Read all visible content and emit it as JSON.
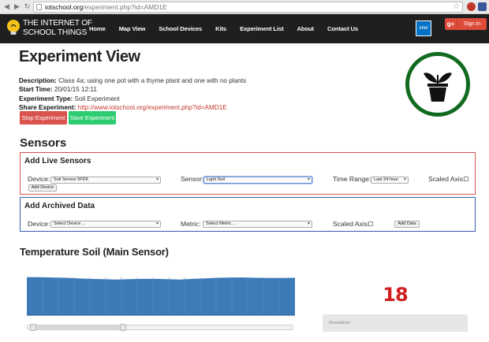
{
  "browser": {
    "url_host": "iotschool.org",
    "url_path": "/experiment.php?id=AMD1E"
  },
  "header": {
    "logo_line1": "THE INTERNET OF",
    "logo_line2": "SCHOOL THINGS",
    "nav": [
      "Home",
      "Map View",
      "School Devices",
      "Kits",
      "Experiment List",
      "About",
      "Contact Us"
    ],
    "intel_label": "intel",
    "signin_gplus": "g+",
    "signin_label": "Sign in"
  },
  "experiment": {
    "title": "Experiment View",
    "description_label": "Description:",
    "description": "Class 4a; using one pot with a thyme plant and one with no plants",
    "start_label": "Start Time:",
    "start_time": "20/01/15 12:11",
    "type_label": "Experiment Type:",
    "type": "Soil Experiment",
    "share_label": "Share Experiment:",
    "share_url": "http://www.iotschool.org/experiment.php?id=AMD1E",
    "stop_button": "Stop Experiment",
    "save_button": "Save Experiment"
  },
  "sensors": {
    "title": "Sensors",
    "live": {
      "title": "Add Live Sensors",
      "device_label": "Device:",
      "device_value": "Soil Sensor 5FD6",
      "sensor_label": "Sensor:",
      "sensor_value": "Light Soil",
      "time_range_label": "Time Range:",
      "time_range_value": "Last 24 hour",
      "scaled_axis_label": "Scaled Axis:",
      "add_button": "Add Device"
    },
    "archive": {
      "title": "Add Archived Data",
      "device_label": "Device:",
      "device_value": "Select Device ...",
      "metric_label": "Metric:",
      "metric_value": "Select Metric ...",
      "scaled_axis_label": "Scaled Axis:",
      "add_button": "Add Data"
    }
  },
  "chart_section": {
    "title": "Temperature Soil (Main Sensor)",
    "current_reading": "18",
    "resolution_label": "Resolution",
    "slider_range": [
      0.02,
      0.36
    ]
  },
  "chart_data": {
    "type": "area",
    "title": "",
    "xlabel": "",
    "ylabel": "",
    "series_color": "#3d7ab8",
    "y": [
      13.0,
      13.0,
      12.9,
      12.8,
      12.6,
      12.4,
      12.3,
      12.2,
      12.3,
      12.4,
      12.4,
      12.3,
      12.2,
      12.4,
      12.6,
      12.8,
      12.9,
      12.9,
      12.8,
      12.7,
      12.7,
      12.8
    ],
    "ylim": [
      0,
      14
    ]
  },
  "colors": {
    "header_bg": "#1f1f1f",
    "stop": "#d9534f",
    "save": "#2ecc71",
    "badge_ring": "#116b1f",
    "reading": "#d01f1f"
  }
}
